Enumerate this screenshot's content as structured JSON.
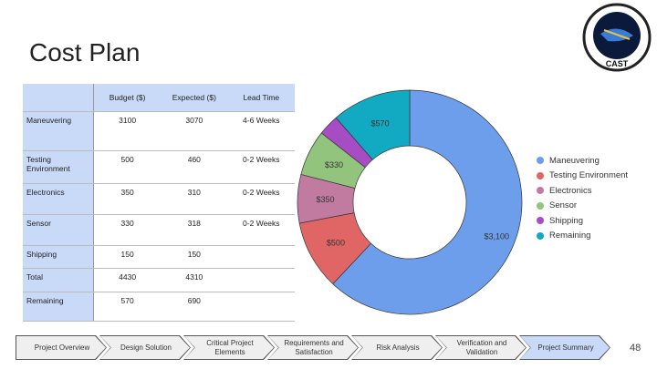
{
  "title": "Cost Plan",
  "logo_text": "CAST",
  "table": {
    "headers": [
      "",
      "Budget ($)",
      "Expected ($)",
      "Lead Time"
    ],
    "rows": [
      [
        "Maneuvering",
        "3100",
        "3070",
        "4-6 Weeks"
      ],
      [
        "Testing Environment",
        "500",
        "460",
        "0-2 Weeks"
      ],
      [
        "Electronics",
        "350",
        "310",
        "0-2 Weeks"
      ],
      [
        "Sensor",
        "330",
        "318",
        "0-2 Weeks"
      ],
      [
        "Shipping",
        "150",
        "150",
        ""
      ],
      [
        "Total",
        "4430",
        "4310",
        ""
      ],
      [
        "Remaining",
        "570",
        "690",
        ""
      ]
    ]
  },
  "chart_data": {
    "type": "pie",
    "donut": true,
    "categories": [
      "Maneuvering",
      "Testing Environment",
      "Electronics",
      "Sensor",
      "Shipping",
      "Remaining"
    ],
    "values": [
      3100,
      500,
      350,
      330,
      150,
      570
    ],
    "labels": [
      "$3,100",
      "$500",
      "$350",
      "$330",
      "",
      "$570"
    ],
    "colors": [
      "#6d9eeb",
      "#e06666",
      "#c27ba0",
      "#93c47d",
      "#a64dc4",
      "#12a9c2"
    ],
    "legend": "right"
  },
  "nav": [
    "Project Overview",
    "Design Solution",
    "Critical Project Elements",
    "Requirements and Satisfaction",
    "Risk Analysis",
    "Verification and Validation",
    "Project Summary"
  ],
  "nav_active": 6,
  "page_number": "48"
}
